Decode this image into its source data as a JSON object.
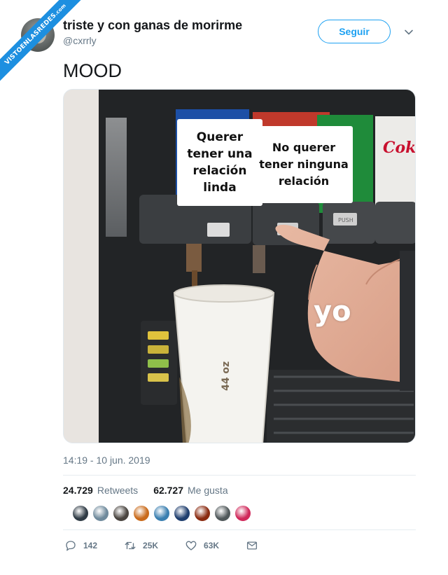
{
  "ribbon": {
    "text_main": "VISTOENLASREDES",
    "text_suffix": ".com"
  },
  "tweet": {
    "display_name": "triste y con ganas de morirme",
    "handle": "@cxrrly",
    "follow_label": "Seguir",
    "text": "MOOD",
    "timestamp": "14:19 - 10 jun. 2019"
  },
  "meme": {
    "label_left": "Querer tener una relación linda",
    "label_right": "No querer tener ninguna relación",
    "label_hand": "yo",
    "cup_text": "44 oz",
    "coke_text": "Coke",
    "push_text": "PUSH"
  },
  "stats": {
    "retweets_count": "24.729",
    "retweets_label": "Retweets",
    "likes_count": "62.727",
    "likes_label": "Me gusta"
  },
  "likers": [
    "#2f3b45",
    "#6f8a9c",
    "#4a4540",
    "#c96a1a",
    "#3a7fb0",
    "#1f3e6e",
    "#8a2a10",
    "#50585a",
    "#d0285a"
  ],
  "actions": {
    "replies": "142",
    "retweets": "25K",
    "likes": "63K"
  },
  "colors": {
    "accent": "#1da1f2",
    "muted": "#657786",
    "ribbon": "#1d8fe0"
  },
  "icons": [
    "chevron-down-icon",
    "reply-icon",
    "retweet-icon",
    "heart-icon",
    "mail-icon"
  ]
}
